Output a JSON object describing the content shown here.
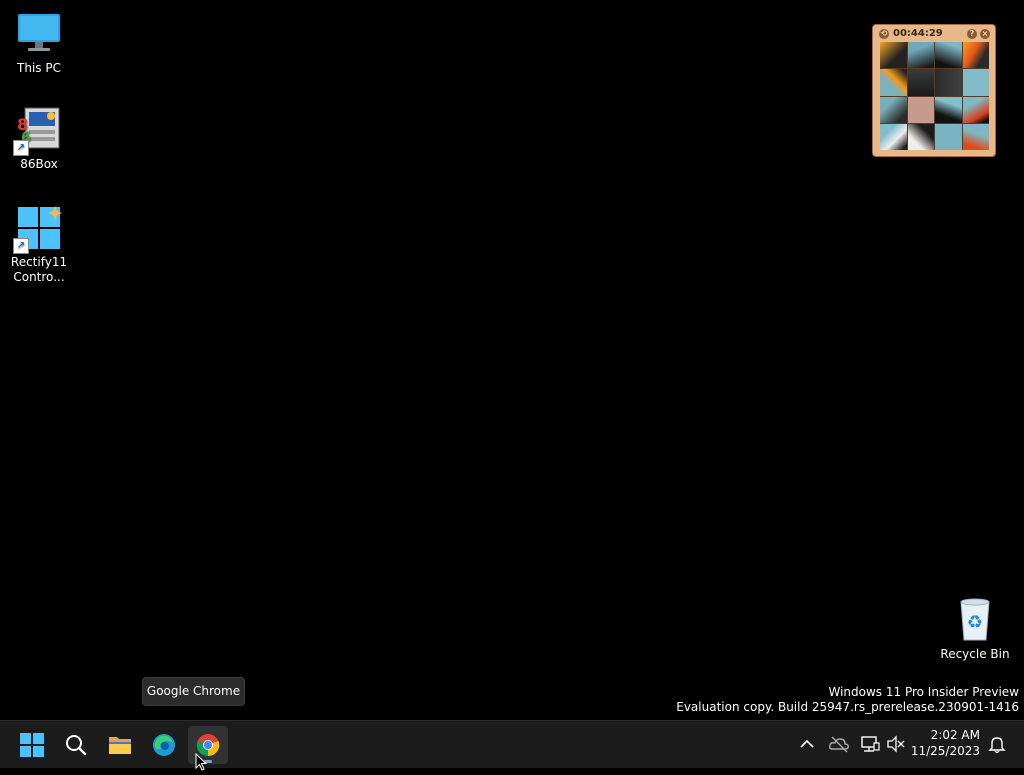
{
  "desktop": {
    "icons": [
      {
        "label": "This PC",
        "icon": "monitor-icon"
      },
      {
        "label": "86Box",
        "icon": "86box-icon"
      },
      {
        "label": "Rectify11 Contro...",
        "icon": "windows-logo-icon"
      }
    ],
    "recycle_bin": {
      "label": "Recycle Bin",
      "icon": "recycle-bin-icon"
    }
  },
  "gadget": {
    "timer": "00:44:29",
    "help_icon": "?",
    "close_icon": "×"
  },
  "watermark": {
    "line1": "Windows 11 Pro Insider Preview",
    "line2": "Evaluation copy. Build 25947.rs_prerelease.230901-1416"
  },
  "tooltip": {
    "text": "Google Chrome"
  },
  "taskbar": {
    "apps": [
      {
        "name": "Start",
        "icon": "windows-start-icon"
      },
      {
        "name": "Search",
        "icon": "search-icon"
      },
      {
        "name": "File Explorer",
        "icon": "folder-icon"
      },
      {
        "name": "Microsoft Edge",
        "icon": "edge-icon"
      },
      {
        "name": "Google Chrome",
        "icon": "chrome-icon",
        "active": true
      }
    ],
    "tray": {
      "time": "2:02 AM",
      "date": "11/25/2023"
    }
  },
  "colors": {
    "taskbar_bg": "#1c1c1c",
    "gadget_frame": "#e7b98a",
    "accent": "#7aa8d6"
  }
}
